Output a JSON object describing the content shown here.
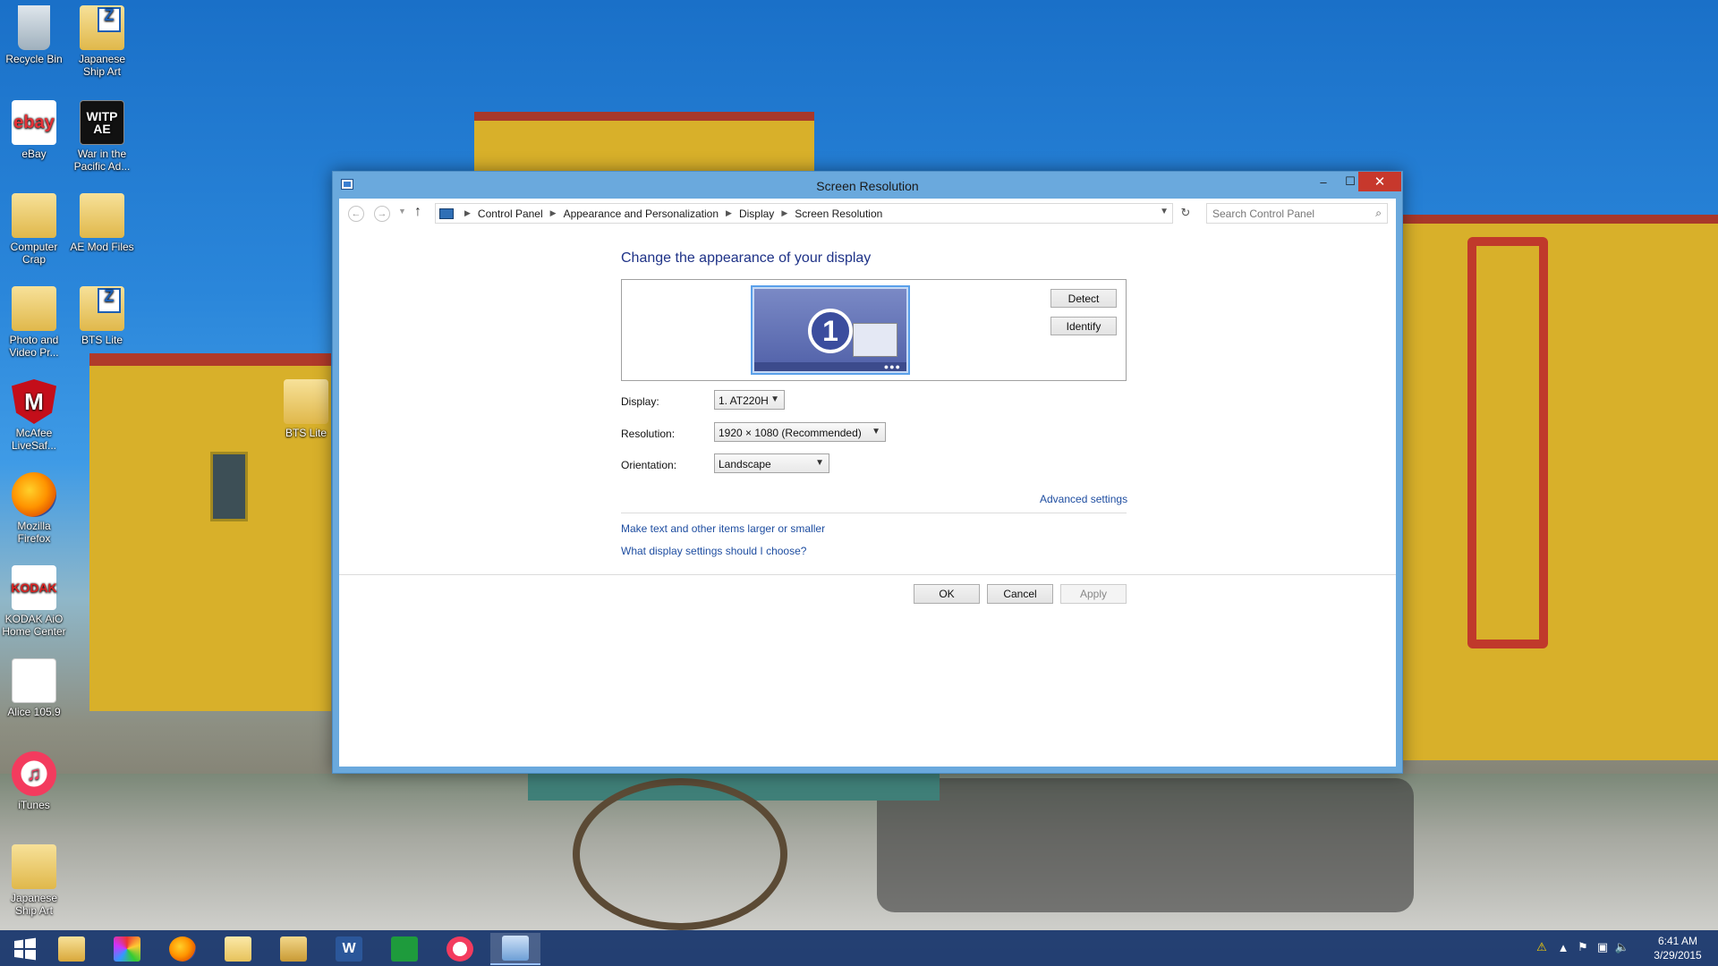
{
  "desktop": {
    "icons": [
      {
        "label": "Recycle Bin"
      },
      {
        "label": "Japanese Ship Art"
      },
      {
        "label": "eBay"
      },
      {
        "label": "War in the Pacific Ad..."
      },
      {
        "label": "Computer Crap"
      },
      {
        "label": "AE Mod Files"
      },
      {
        "label": "Photo and Video Pr..."
      },
      {
        "label": "BTS Lite"
      },
      {
        "label": "McAfee LiveSaf..."
      },
      {
        "label": "BTS Lite"
      },
      {
        "label": "Mozilla Firefox"
      },
      {
        "label": "KODAK AiO Home Center"
      },
      {
        "label": "Alice 105.9"
      },
      {
        "label": "iTunes"
      },
      {
        "label": "Japanese Ship Art"
      }
    ],
    "icon_glyphs": {
      "ebay": "ebay",
      "witp": "WITP AE",
      "mcafee": "M",
      "kodak": "KODAK",
      "itunes": "♫"
    }
  },
  "window": {
    "title": "Screen Resolution",
    "controls": {
      "minimize": "–",
      "maximize": "☐",
      "close": "✕"
    },
    "nav": {
      "breadcrumbs": [
        "Control Panel",
        "Appearance and Personalization",
        "Display",
        "Screen Resolution"
      ],
      "search_placeholder": "Search Control Panel"
    },
    "heading": "Change the appearance of your display",
    "monitor_number": "1",
    "buttons": {
      "detect": "Detect",
      "identify": "Identify",
      "ok": "OK",
      "cancel": "Cancel",
      "apply": "Apply"
    },
    "fields": {
      "display_label": "Display:",
      "display_value": "1. AT220H",
      "resolution_label": "Resolution:",
      "resolution_value": "1920 × 1080 (Recommended)",
      "orientation_label": "Orientation:",
      "orientation_value": "Landscape"
    },
    "links": {
      "advanced": "Advanced settings",
      "text_size": "Make text and other items larger or smaller",
      "help": "What display settings should I choose?"
    }
  },
  "taskbar": {
    "apps": [
      "start-button",
      "file-explorer",
      "photo-app",
      "firefox",
      "folder",
      "explorer-window",
      "word",
      "store",
      "itunes",
      "control-panel"
    ],
    "clock": {
      "time": "6:41 AM",
      "date": "3/29/2015"
    }
  },
  "colors": {
    "accent": "#6aa9dd",
    "link": "#1f4ea1",
    "heading": "#1e3287",
    "close": "#c7382c"
  }
}
